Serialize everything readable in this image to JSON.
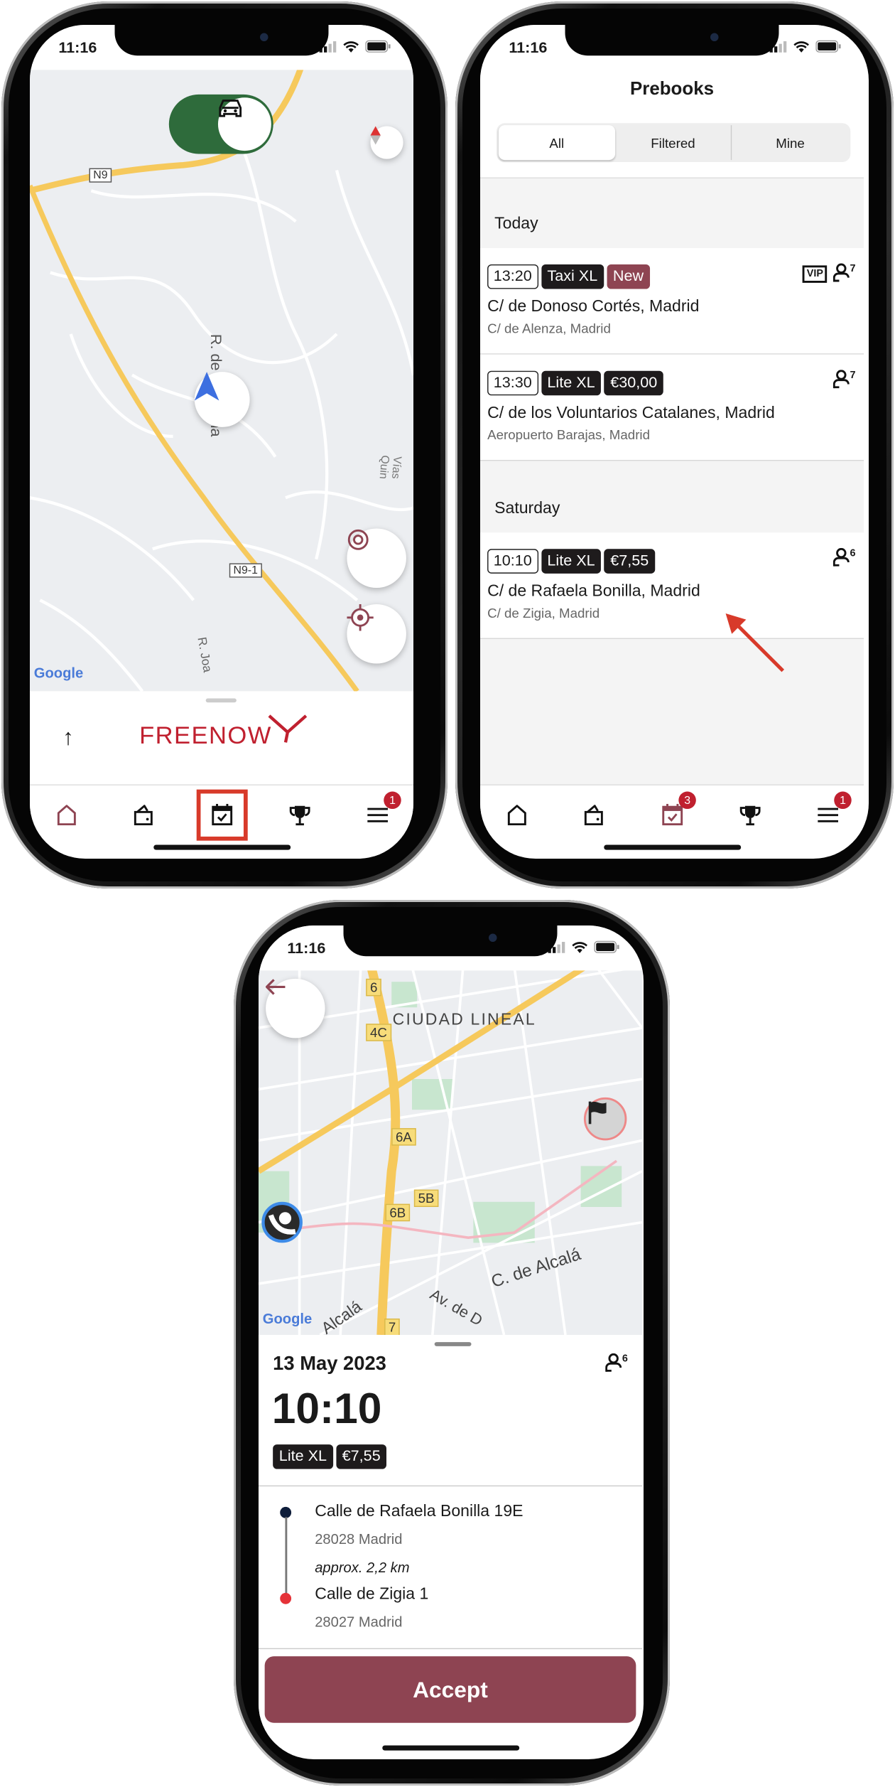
{
  "status_time": "11:16",
  "colors": {
    "brand": "#c0202f",
    "accent": "#8e4452",
    "toggle_on": "#2e6b3b",
    "chip_dark": "#1e1b1c",
    "route": "#f4b6c0"
  },
  "screen1": {
    "map": {
      "road_labels": [
        "N9",
        "R. de Sant'Ana",
        "N9-1",
        "R. Joa",
        "Vías Quin"
      ],
      "attribution": "Google"
    },
    "toggle": {
      "state": "on",
      "icon": "car-icon"
    },
    "logo_text": "FREENOW",
    "expand_icon": "arrow-up-icon",
    "tabs": [
      {
        "icon": "home-icon",
        "active": true
      },
      {
        "icon": "wallet-icon"
      },
      {
        "icon": "calendar-check-icon",
        "highlighted": true
      },
      {
        "icon": "trophy-icon"
      },
      {
        "icon": "menu-icon",
        "badge": "1"
      }
    ]
  },
  "screen2": {
    "title": "Prebooks",
    "segments": [
      {
        "label": "All",
        "selected": true
      },
      {
        "label": "Filtered"
      },
      {
        "label": "Mine"
      }
    ],
    "sections": [
      {
        "header": "Today",
        "items": [
          {
            "time": "13:20",
            "category": "Taxi XL",
            "tag": "New",
            "vip": "VIP",
            "passengers": "7",
            "pickup": "C/ de Donoso Cortés, Madrid",
            "dropoff": "C/ de Alenza, Madrid"
          },
          {
            "time": "13:30",
            "category": "Lite XL",
            "price": "€30,00",
            "passengers": "7",
            "pickup": "C/ de los Voluntarios Catalanes, Madrid",
            "dropoff": "Aeropuerto Barajas, Madrid"
          }
        ]
      },
      {
        "header": "Saturday",
        "items": [
          {
            "time": "10:10",
            "category": "Lite XL",
            "price": "€7,55",
            "passengers": "6",
            "pickup": "C/ de Rafaela Bonilla, Madrid",
            "dropoff": "C/ de Zigia, Madrid"
          }
        ]
      }
    ],
    "tabs": [
      {
        "icon": "home-icon"
      },
      {
        "icon": "wallet-icon"
      },
      {
        "icon": "calendar-check-icon",
        "active": true,
        "badge": "3"
      },
      {
        "icon": "trophy-icon"
      },
      {
        "icon": "menu-icon",
        "badge": "1"
      }
    ]
  },
  "screen3": {
    "map": {
      "labels": [
        "CIUDAD LINEAL",
        "C. de Alcalá",
        "Alcalá",
        "Av. de D"
      ],
      "exits": [
        "6",
        "4C",
        "6A",
        "5B",
        "6B",
        "7"
      ],
      "attribution": "Google"
    },
    "date": "13 May 2023",
    "time": "10:10",
    "passengers": "6",
    "category": "Lite XL",
    "price": "€7,55",
    "pickup": {
      "street": "Calle de Rafaela Bonilla 19E",
      "city": "28028 Madrid"
    },
    "distance": "approx. 2,2 km",
    "dropoff": {
      "street": "Calle de Zigia 1",
      "city": "28027 Madrid"
    },
    "accept_label": "Accept"
  }
}
